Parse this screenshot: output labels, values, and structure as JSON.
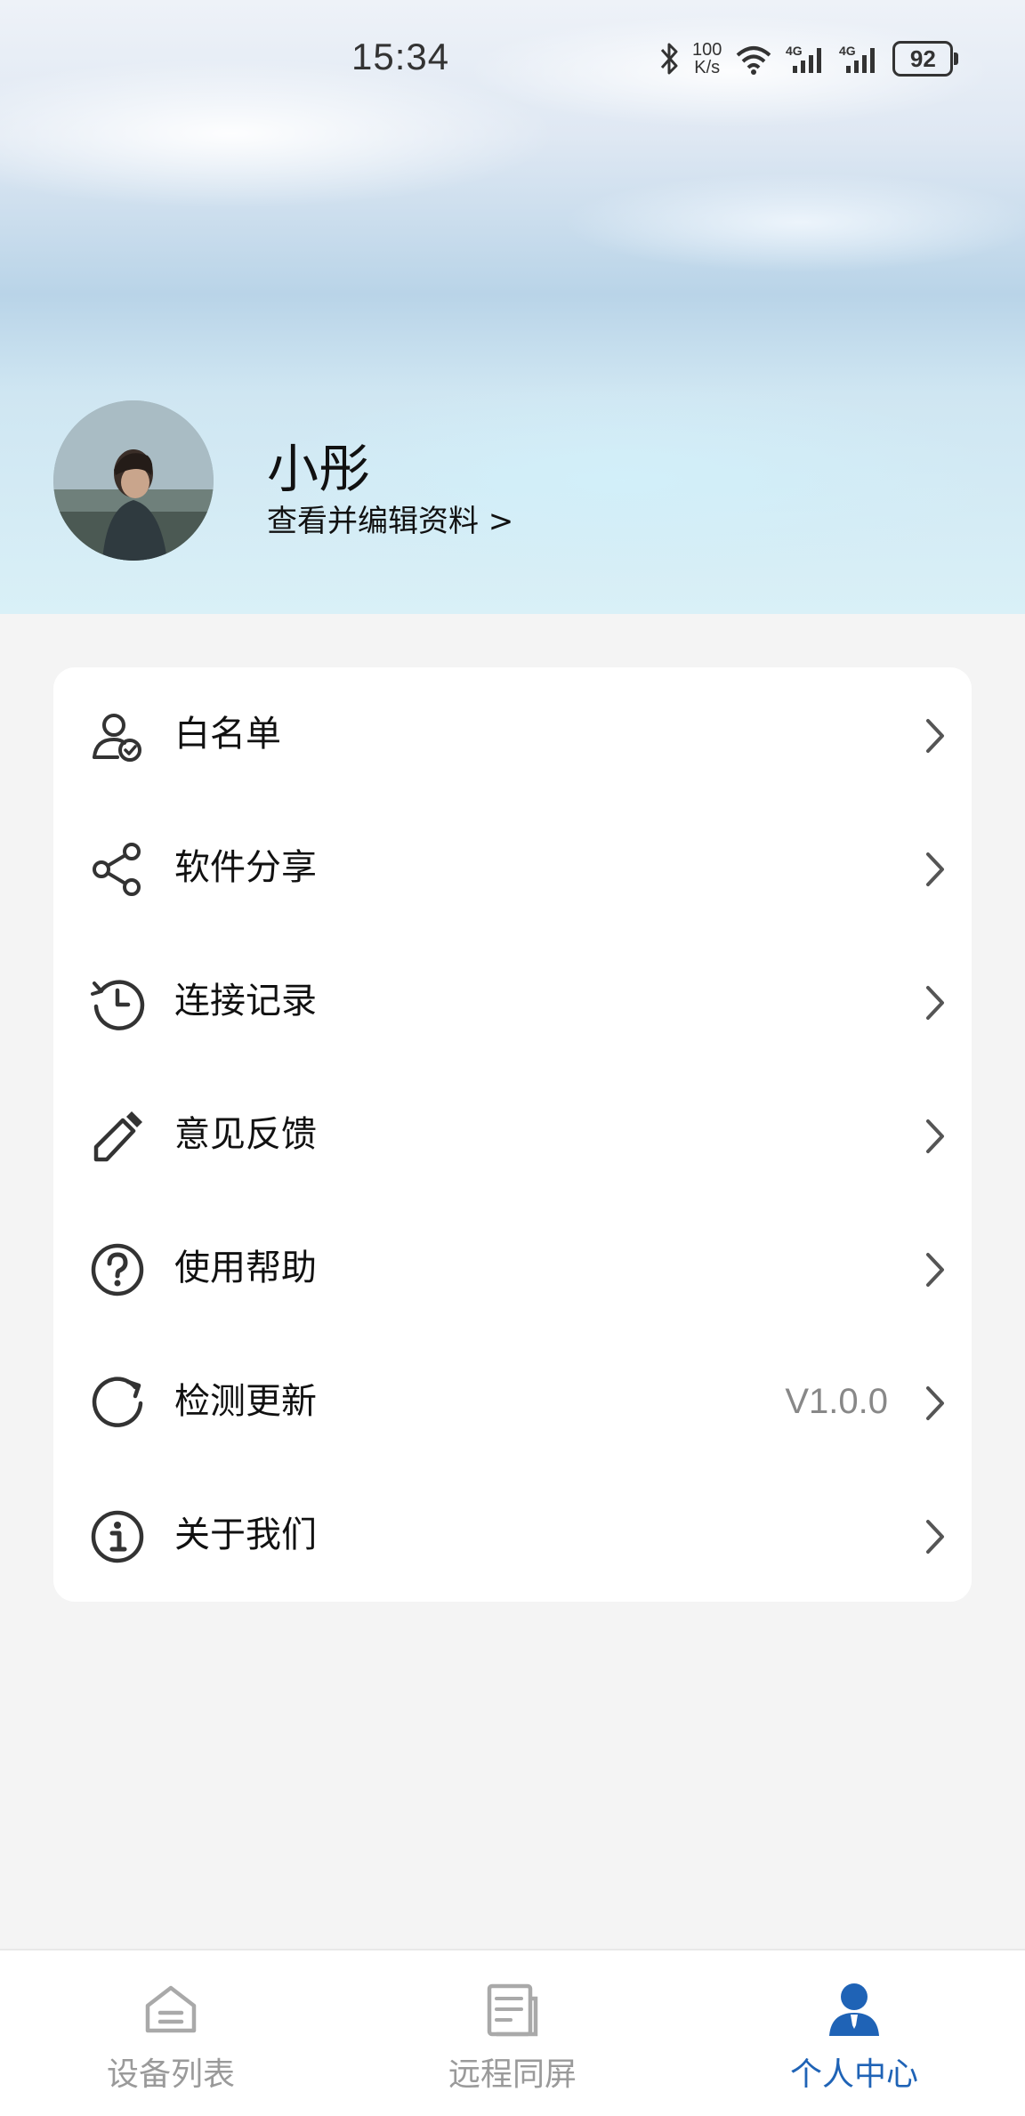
{
  "status_bar": {
    "time": "15:34",
    "net_speed_value": "100",
    "net_speed_unit": "K/s",
    "battery": "92",
    "icons": [
      "bluetooth-icon",
      "wifi-icon",
      "signal-4g-icon",
      "signal-4g-icon"
    ]
  },
  "profile": {
    "name": "小彤",
    "edit_link": "查看并编辑资料 >"
  },
  "menu": {
    "items": [
      {
        "label": "白名单",
        "icon": "user-check-icon"
      },
      {
        "label": "软件分享",
        "icon": "share-icon"
      },
      {
        "label": "连接记录",
        "icon": "history-icon"
      },
      {
        "label": "意见反馈",
        "icon": "pencil-icon"
      },
      {
        "label": "使用帮助",
        "icon": "help-icon"
      },
      {
        "label": "检测更新",
        "icon": "refresh-icon",
        "value": "V1.0.0"
      },
      {
        "label": "关于我们",
        "icon": "info-icon"
      }
    ]
  },
  "bottom_nav": {
    "items": [
      {
        "label": "设备列表",
        "icon": "device-list-icon"
      },
      {
        "label": "远程同屏",
        "icon": "remote-screen-icon"
      },
      {
        "label": "个人中心",
        "icon": "person-icon",
        "active": true
      }
    ]
  },
  "colors": {
    "accent": "#1f63b6",
    "inactive": "#9a9a9a",
    "icon": "#333333"
  }
}
